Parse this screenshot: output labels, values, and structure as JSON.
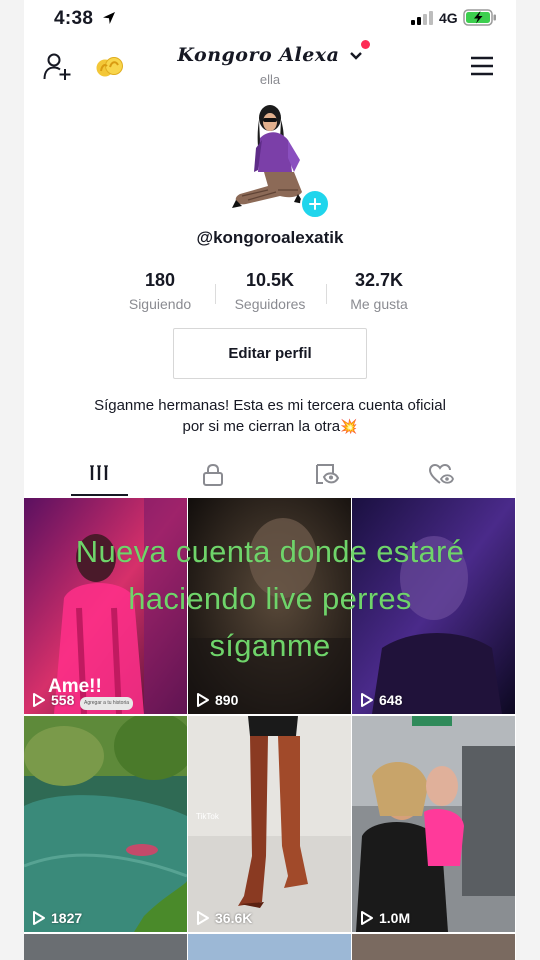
{
  "status_bar": {
    "time": "4:38",
    "network": "4G"
  },
  "header": {
    "title": "Kongoro Alexa",
    "subtitle": "ella"
  },
  "profile": {
    "handle": "@kongoroalexatik",
    "stats": [
      {
        "value": "180",
        "label": "Siguiendo"
      },
      {
        "value": "10.5K",
        "label": "Seguidores"
      },
      {
        "value": "32.7K",
        "label": "Me gusta"
      }
    ],
    "edit_label": "Editar perfil",
    "bio_line1": "Síganme hermanas! Esta es mi tercera cuenta oficial",
    "bio_line2": "por si me cierran la otra",
    "bio_emoji": "💥"
  },
  "tabs": [
    {
      "icon": "videos-grid-icon",
      "active": true
    },
    {
      "icon": "lock-icon",
      "active": false
    },
    {
      "icon": "tagged-icon",
      "active": false
    },
    {
      "icon": "liked-heart-icon",
      "active": false
    }
  ],
  "videos": [
    {
      "views": "558"
    },
    {
      "views": "890"
    },
    {
      "views": "648"
    },
    {
      "views": "1827"
    },
    {
      "views": "36.6K"
    },
    {
      "views": "1.0M"
    }
  ],
  "overlay": {
    "line1": "Nueva cuenta donde estaré",
    "line2": "haciendo live perres",
    "line3": "síganme"
  },
  "thumb_caption": "Ame!!",
  "sticker_text": "Agregar a tu historia",
  "watermark": "TikTok",
  "colors": {
    "accent": "#fe2c55",
    "plus": "#20d5ec",
    "overlay_text": "#6fd46a"
  }
}
